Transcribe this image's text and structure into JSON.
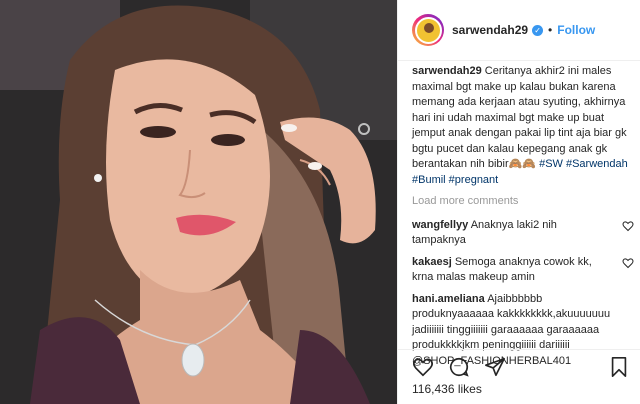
{
  "header": {
    "username": "sarwendah29",
    "verified_icon": "verified-badge-icon",
    "separator": "•",
    "follow_label": "Follow",
    "accent_color": "#3897f0"
  },
  "caption": {
    "username": "sarwendah29",
    "text": "Ceritanya akhir2 ini males maximal bgt make up kalau bukan karena memang ada kerjaan atau syuting, akhirnya hari ini udah maximal bgt make up buat jemput anak dengan pakai lip tint aja biar gk bgtu pucet dan kalau kepegang anak gk berantakan nih bibir🙈🙈",
    "tags": "#SW #Sarwendah #Bumil #pregnant"
  },
  "load_more_label": "Load more comments",
  "comments": [
    {
      "username": "wangfellyy",
      "text": "Anaknya laki2 nih tampaknya"
    },
    {
      "username": "kakaesj",
      "text": "Semoga anaknya cowok kk, krna malas makeup amin"
    },
    {
      "username": "hani.ameliana",
      "text": "Ajaibbbbbb produknyaaaaaa kakkkkkkkk,akuuuuuuu jadiiiiiii tinggiiiiiii garaaaaaa garaaaaaa produkkkkjkm peninggiiiiii dariiiiii @SHOP_FASHIONHERBAL401"
    }
  ],
  "likes": "116,436 likes",
  "icons": [
    "heart-icon",
    "comment-icon",
    "share-icon",
    "bookmark-icon"
  ]
}
